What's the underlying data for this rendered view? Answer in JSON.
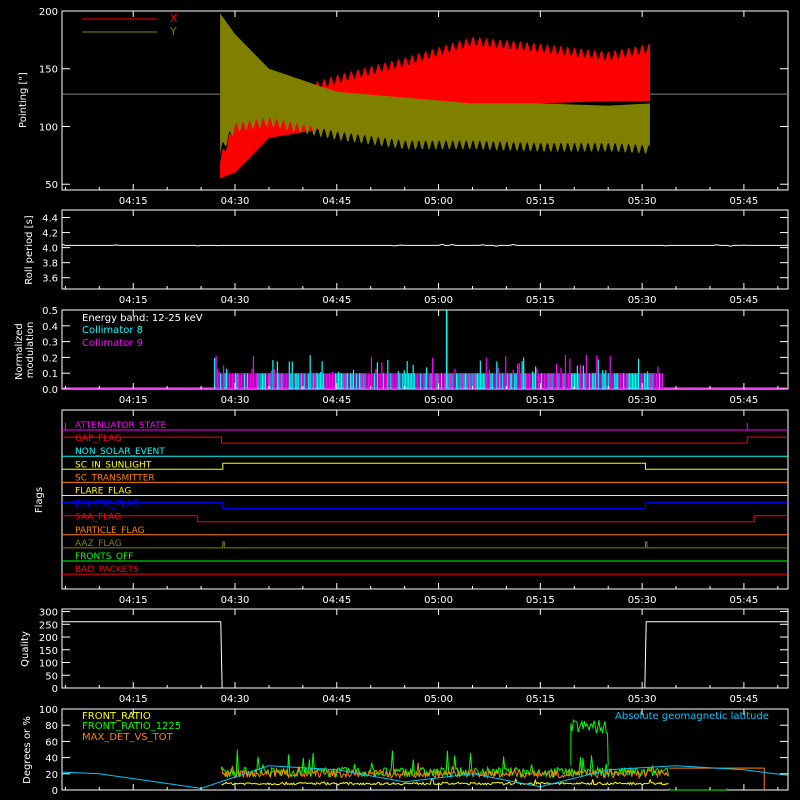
{
  "time_ticks": [
    "04:15",
    "04:30",
    "04:45",
    "05:00",
    "05:15",
    "05:30",
    "05:45"
  ],
  "time_ticks_minutes": [
    15,
    30,
    45,
    60,
    75,
    90,
    105
  ],
  "time_range_minutes": [
    4.5,
    111.5
  ],
  "colors": {
    "x_series": "#ff0000",
    "y_series": "#808000",
    "collimator8": "#00ffff",
    "collimator9": "#ff00ff",
    "axis": "#ffffff",
    "front_ratio": "#ffff00",
    "front_ratio_1225": "#00ff00",
    "max_det_vs_tot": "#ff8000",
    "geomag": "#00c8ff"
  },
  "chart_data": [
    {
      "id": "pointing",
      "type": "area",
      "ylabel": "Pointing [\"]",
      "ylim": [
        45,
        200
      ],
      "yticks": [
        50,
        100,
        150,
        200
      ],
      "legend_position": "top-left",
      "series": [
        {
          "name": "X",
          "color": "#ff0000",
          "start_min": 27.8,
          "end_min": 91.2,
          "lower_env": [
            [
              27.8,
              55
            ],
            [
              30,
              60
            ],
            [
              35,
              90
            ],
            [
              45,
              100
            ],
            [
              55,
              110
            ],
            [
              65,
              118
            ],
            [
              75,
              120
            ],
            [
              85,
              122
            ],
            [
              91.2,
              122
            ]
          ],
          "upper_env": [
            [
              27.8,
              75
            ],
            [
              30,
              105
            ],
            [
              35,
              125
            ],
            [
              45,
              145
            ],
            [
              55,
              160
            ],
            [
              65,
              178
            ],
            [
              75,
              172
            ],
            [
              85,
              165
            ],
            [
              91.2,
              172
            ]
          ]
        },
        {
          "name": "Y",
          "color": "#808000",
          "start_min": 27.8,
          "end_min": 91.2,
          "lower_env": [
            [
              27.8,
              75
            ],
            [
              30,
              95
            ],
            [
              35,
              100
            ],
            [
              45,
              88
            ],
            [
              55,
              80
            ],
            [
              65,
              80
            ],
            [
              75,
              78
            ],
            [
              85,
              78
            ],
            [
              91.2,
              76
            ]
          ],
          "upper_env": [
            [
              27.8,
              198
            ],
            [
              30,
              180
            ],
            [
              35,
              150
            ],
            [
              45,
              130
            ],
            [
              55,
              125
            ],
            [
              65,
              120
            ],
            [
              75,
              120
            ],
            [
              85,
              118
            ],
            [
              91.2,
              120
            ]
          ]
        }
      ],
      "baseline": 128
    },
    {
      "id": "roll_period",
      "type": "line",
      "ylabel": "Roll period [s]",
      "ylim": [
        3.45,
        4.5
      ],
      "yticks": [
        "3.6",
        "3.8",
        "4.0",
        "4.2",
        "4.4"
      ],
      "value": 4.03
    },
    {
      "id": "modulation",
      "type": "bar",
      "ylabel": "Normalized modulation",
      "ylim": [
        0,
        0.5
      ],
      "yticks": [
        "0.0",
        "0.1",
        "0.2",
        "0.3",
        "0.4",
        "0.5"
      ],
      "annotations": [
        "Energy band: 12-25 keV"
      ],
      "series": [
        {
          "name": "Collimator 8",
          "color": "#00ffff"
        },
        {
          "name": "Collimator 9",
          "color": "#ff00ff"
        }
      ],
      "active_range_min": [
        27.0,
        93.0
      ],
      "spike_min": 61.2,
      "spike_value": 0.5,
      "baseline_value": 0.1
    },
    {
      "id": "flags",
      "type": "line",
      "ylabel": "Flags",
      "flags": [
        {
          "name": "ATTENUATOR_STATE",
          "color": "#ff00ff",
          "steps": []
        },
        {
          "name": "GAP_FLAG",
          "color": "#ff0000",
          "steps": [
            [
              4.5,
              1
            ],
            [
              28.0,
              0
            ],
            [
              105.5,
              1
            ]
          ]
        },
        {
          "name": "NON_SOLAR_EVENT",
          "color": "#00ffff",
          "steps": []
        },
        {
          "name": "SC_IN_SUNLIGHT",
          "color": "#ffff00",
          "steps": [
            [
              4.5,
              0
            ],
            [
              28.2,
              1
            ],
            [
              90.5,
              0
            ]
          ]
        },
        {
          "name": "SC_TRANSMITTER",
          "color": "#ff8000",
          "steps": []
        },
        {
          "name": "FLARE_FLAG",
          "color": "#ffff00",
          "steps": []
        },
        {
          "name": "ECLIPSE_FLAG",
          "color": "#0000ff",
          "steps": [
            [
              4.5,
              1
            ],
            [
              28.2,
              0
            ],
            [
              90.5,
              1
            ]
          ]
        },
        {
          "name": "SAA_FLAG",
          "color": "#ff0000",
          "steps": [
            [
              4.5,
              1
            ],
            [
              24.5,
              0
            ],
            [
              106.5,
              1
            ]
          ]
        },
        {
          "name": "PARTICLE_FLAG",
          "color": "#ff8000",
          "steps": []
        },
        {
          "name": "AAZ_FLAG",
          "color": "#808000",
          "steps": [
            [
              28.2,
              1
            ],
            [
              90.5,
              1
            ]
          ]
        },
        {
          "name": "FRONTS_OFF",
          "color": "#00ff00",
          "steps": []
        },
        {
          "name": "BAD_PACKETS",
          "color": "#ff0000",
          "steps": []
        }
      ]
    },
    {
      "id": "quality",
      "type": "line",
      "ylabel": "Quality",
      "ylim": [
        0,
        310
      ],
      "yticks": [
        "0",
        "50",
        "100",
        "150",
        "200",
        "250",
        "300"
      ],
      "points": [
        [
          4.5,
          260
        ],
        [
          27.9,
          260
        ],
        [
          28.1,
          0
        ],
        [
          90.4,
          0
        ],
        [
          90.6,
          260
        ],
        [
          111.5,
          260
        ]
      ]
    },
    {
      "id": "ratios",
      "type": "line",
      "ylabel": "Degrees or %",
      "ylim": [
        0,
        100
      ],
      "yticks": [
        "0",
        "20",
        "40",
        "60",
        "80",
        "100"
      ],
      "series": [
        {
          "name": "FRONT_RATIO",
          "color": "#ffff00"
        },
        {
          "name": "FRONT_RATIO_1225",
          "color": "#00ff00"
        },
        {
          "name": "MAX_DET_VS_TOT",
          "color": "#ff8000"
        },
        {
          "name": "Absolute geomagnetic latitude",
          "color": "#00c8ff"
        }
      ],
      "geomag_points": [
        [
          4.5,
          22
        ],
        [
          10,
          20
        ],
        [
          25,
          2
        ],
        [
          35,
          30
        ],
        [
          45,
          25
        ],
        [
          55,
          10
        ],
        [
          65,
          20
        ],
        [
          75,
          4
        ],
        [
          85,
          25
        ],
        [
          95,
          30
        ],
        [
          105,
          25
        ],
        [
          111.5,
          18
        ]
      ]
    }
  ]
}
